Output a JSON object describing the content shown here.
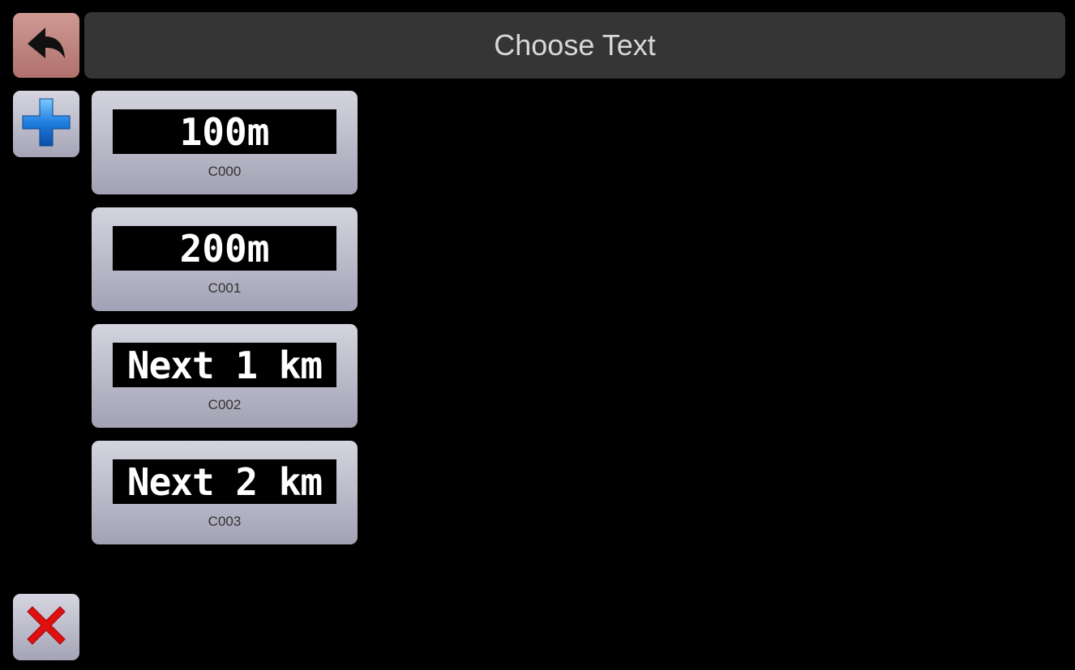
{
  "header": {
    "title": "Choose Text"
  },
  "icons": {
    "back": "back-arrow-icon",
    "add": "plus-icon",
    "close": "close-x-icon"
  },
  "colors": {
    "back_button": "#c08580",
    "title_bar": "#353535",
    "item_button": "#bcbccb",
    "plus": "#1f7fe0",
    "close_x": "#e01010"
  },
  "items": [
    {
      "preview": "100m",
      "code": "C000"
    },
    {
      "preview": "200m",
      "code": "C001"
    },
    {
      "preview": "Next 1 km",
      "code": "C002"
    },
    {
      "preview": "Next 2 km",
      "code": "C003"
    }
  ]
}
